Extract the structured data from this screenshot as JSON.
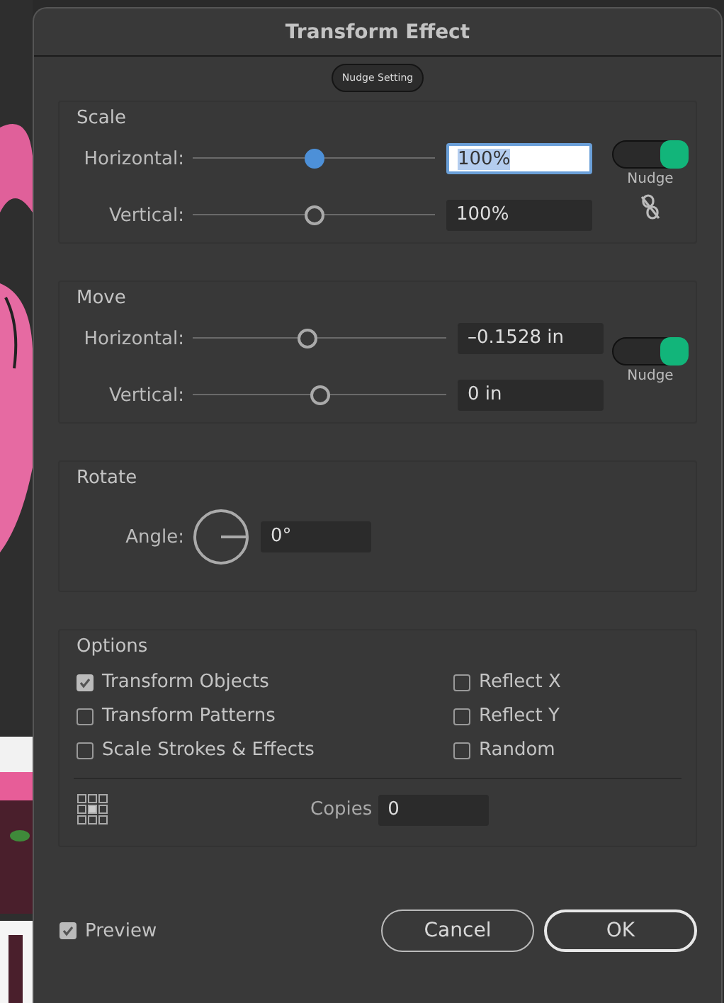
{
  "window": {
    "title": "Transform Effect"
  },
  "nudge_setting": "Nudge Setting",
  "scale": {
    "label": "Scale",
    "rows": [
      {
        "label": "Horizontal:",
        "level": 0.5,
        "active": true,
        "value": "100%",
        "focused": true
      },
      {
        "label": "Vertical:",
        "level": 0.5,
        "active": false,
        "value": "100%",
        "focused": false
      }
    ],
    "nudge": {
      "label": "Nudge",
      "on": true
    }
  },
  "move": {
    "label": "Move",
    "rows": [
      {
        "label": "Horizontal:",
        "level": 0.45,
        "active": false,
        "value": "–0.1528 in",
        "focused": false
      },
      {
        "label": "Vertical:",
        "level": 0.5,
        "active": false,
        "value": "0 in",
        "focused": false
      }
    ],
    "nudge": {
      "label": "Nudge",
      "on": true
    }
  },
  "rotate": {
    "label": "Rotate",
    "angle_label": "Angle:",
    "value": "0°"
  },
  "options": {
    "label": "Options",
    "checkboxes": [
      {
        "label": "Transform Objects",
        "checked": true
      },
      {
        "label": "Reflect X",
        "checked": false
      },
      {
        "label": "Transform Patterns",
        "checked": false
      },
      {
        "label": "Reflect Y",
        "checked": false
      },
      {
        "label": "Scale Strokes & Effects",
        "checked": false
      },
      {
        "label": "Random",
        "checked": false
      }
    ],
    "copies_label": "Copies",
    "copies_value": "0"
  },
  "preview": {
    "label": "Preview",
    "checked": true
  },
  "buttons": [
    {
      "label": "Cancel",
      "default": false
    },
    {
      "label": "OK",
      "default": true
    }
  ]
}
